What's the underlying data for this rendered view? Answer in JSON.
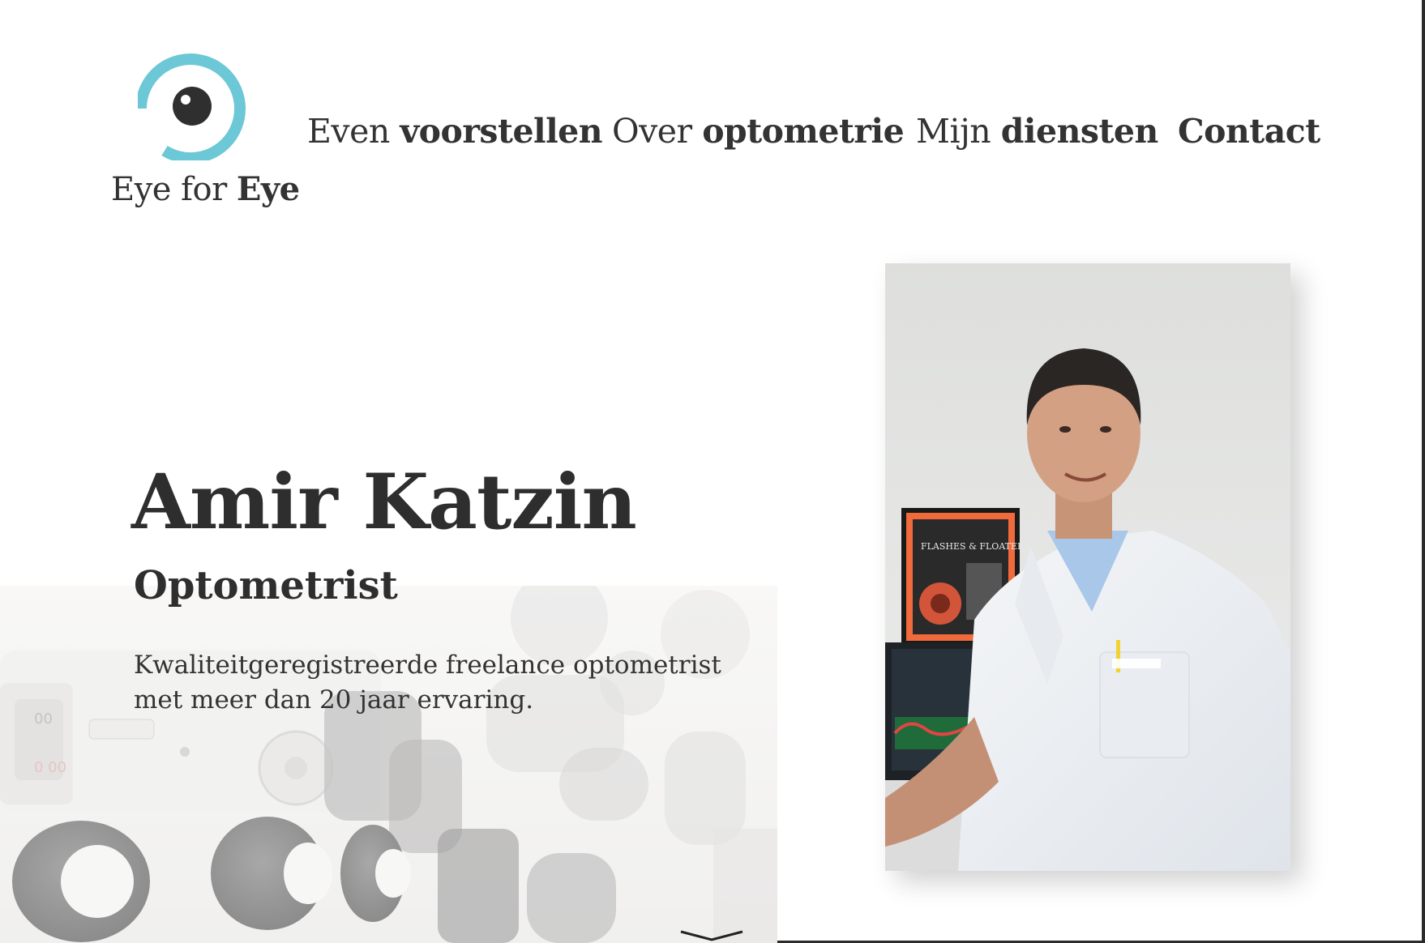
{
  "brand": {
    "name_regular": "Eye for",
    "name_bold": "Eye",
    "accent_color": "#6cc7d6",
    "text_color": "#333333"
  },
  "nav": {
    "items": [
      {
        "regular": "Even",
        "bold": "voorstellen"
      },
      {
        "regular": "Over",
        "bold": "optometrie"
      },
      {
        "regular": "Mijn",
        "bold": "diensten"
      },
      {
        "regular": "",
        "bold": "Contact"
      }
    ]
  },
  "hero": {
    "name": "Amir Katzin",
    "role": "Optometrist",
    "description": "Kwaliteitgeregistreerde freelance optometrist met meer dan 20 jaar ervaring."
  },
  "portrait": {
    "poster_title": "FLASHES & FLOATERS"
  },
  "icons": {
    "logo": "eye-logo-icon",
    "scroll": "chevron-down-icon"
  }
}
